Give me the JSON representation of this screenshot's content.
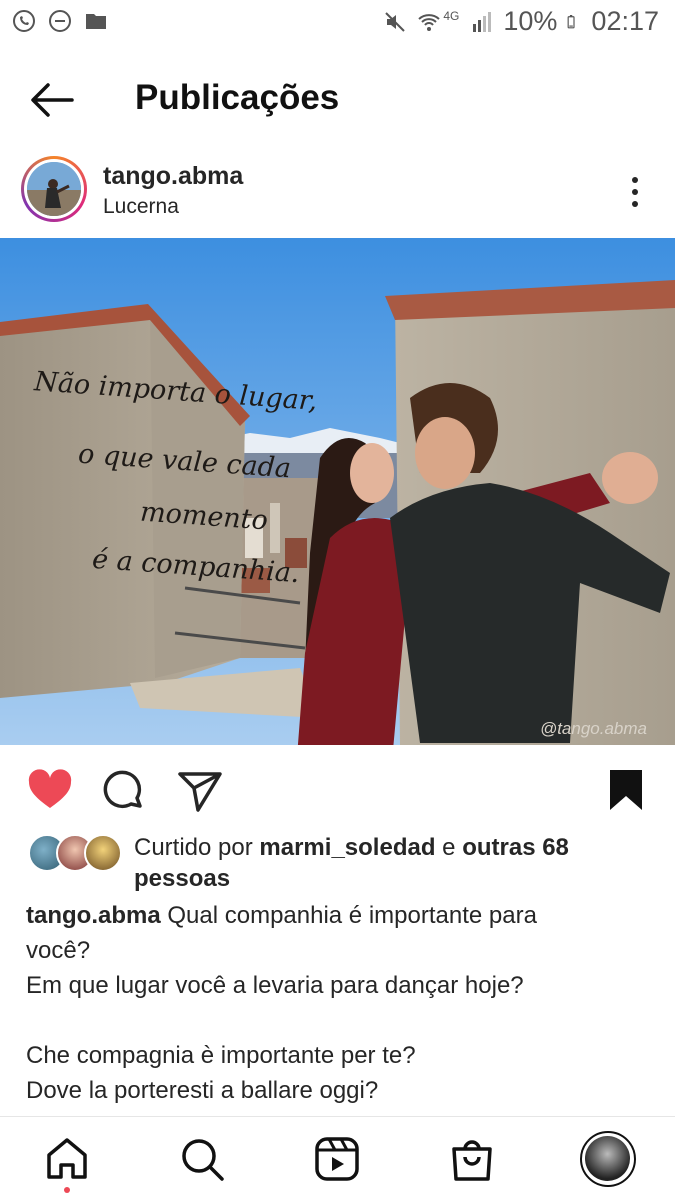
{
  "status_bar": {
    "battery": "10%",
    "time": "02:17",
    "network": "4G",
    "icons": [
      "whatsapp-icon",
      "do-not-disturb-icon",
      "folder-icon",
      "mute-icon",
      "wifi-icon",
      "signal-icon",
      "battery-icon"
    ]
  },
  "header": {
    "title": "Publicações"
  },
  "post": {
    "username": "tango.abma",
    "location": "Lucerna",
    "photo": {
      "overlay_lines": [
        "Não importa o lugar,",
        "o que vale cada",
        "momento",
        "é a companhia."
      ],
      "watermark": "@tango.abma"
    },
    "liked": true,
    "saved": true,
    "likes": {
      "prefix": "Curtido por",
      "user": "marmi_soledad",
      "conj": "e",
      "others": "outras 68 pessoas"
    },
    "caption": {
      "username": "tango.abma",
      "first_line": "Qual companhia é importante para",
      "lines": [
        "você?",
        "Em que lugar você a levaria para dançar hoje?",
        "",
        "Che compagnia è importante per te?",
        "Dove la porteresti a ballare oggi?"
      ]
    }
  },
  "colors": {
    "like": "#ed4956",
    "text": "#262626",
    "brand_gradient": [
      "#f58529",
      "#dd2a7b",
      "#8134af"
    ]
  },
  "bottom_nav": [
    "home-icon",
    "search-icon",
    "reels-icon",
    "shop-icon",
    "profile-avatar"
  ]
}
